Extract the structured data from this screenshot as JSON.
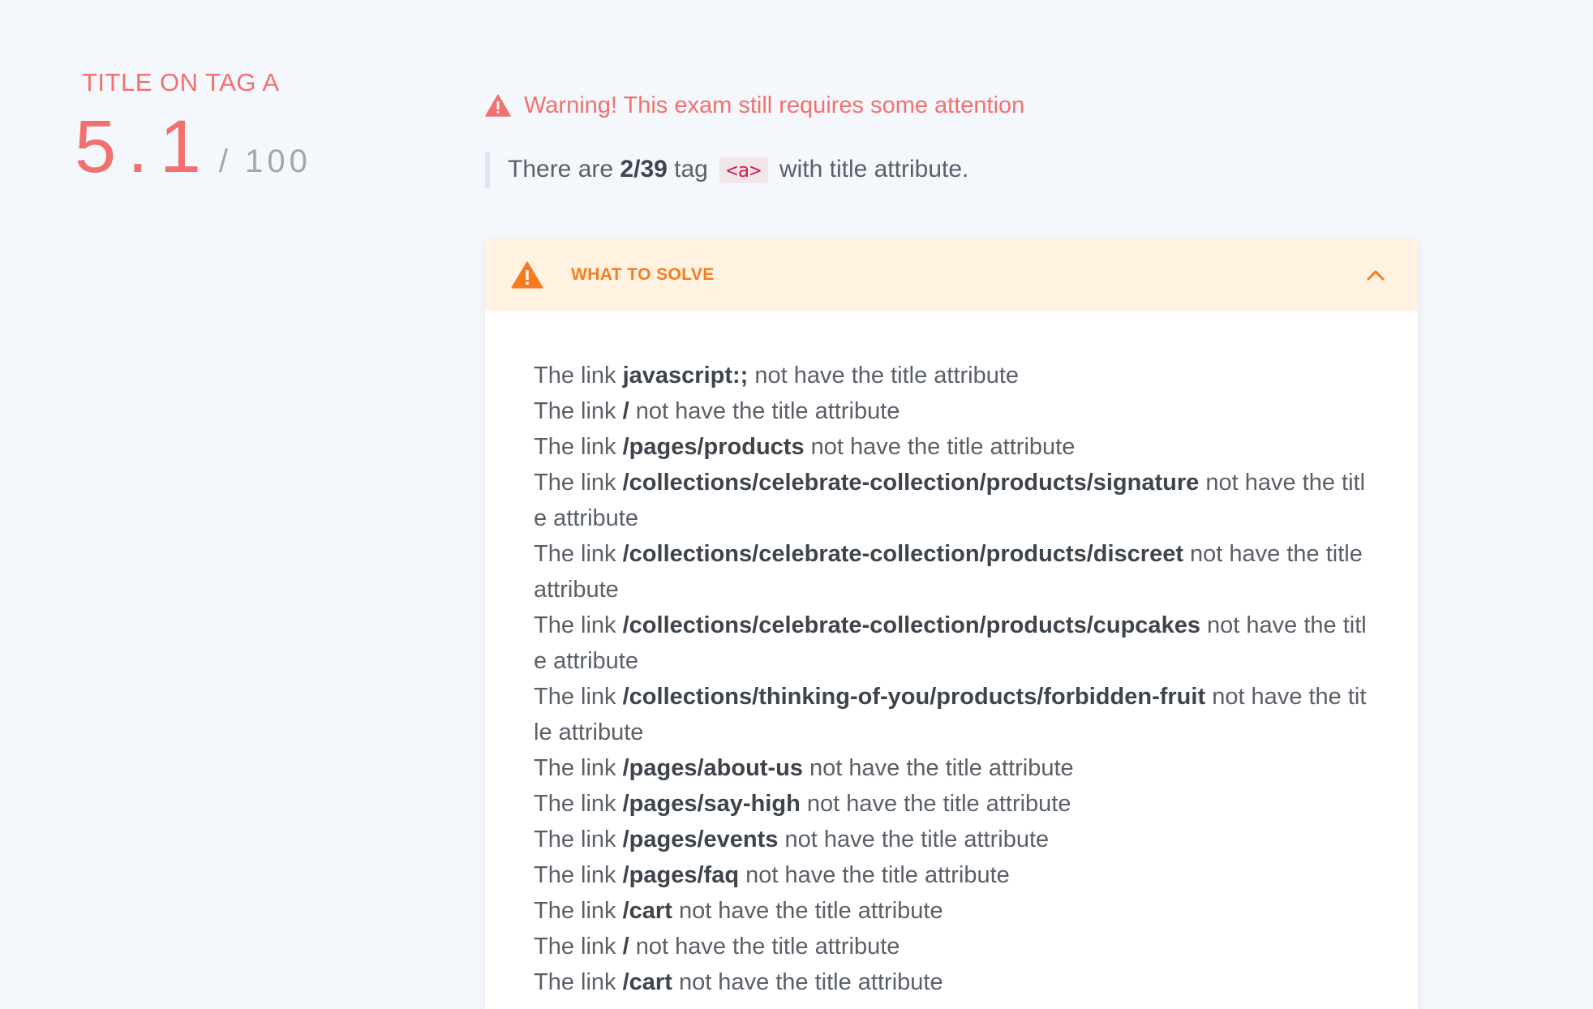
{
  "score": {
    "title": "TITLE ON TAG A",
    "value": "5.1",
    "max": "/ 100"
  },
  "warning": {
    "icon": "warning-triangle-icon",
    "text": "Warning! This exam still requires some attention",
    "color": "#f2716f"
  },
  "summary": {
    "prefix": "There are",
    "count": "2/39",
    "middle": "tag",
    "tag": "<a>",
    "suffix": "with title attribute."
  },
  "solve_panel": {
    "icon": "warning-triangle-icon",
    "label": "WHAT TO SOLVE",
    "toggle_icon": "chevron-up-icon",
    "accent_color": "#f57c1f",
    "header_bg": "#fff2e0",
    "items": [
      {
        "prefix": "The link",
        "link": "javascript:;",
        "suffix": "not have the title attribute"
      },
      {
        "prefix": "The link",
        "link": "/",
        "suffix": "not have the title attribute"
      },
      {
        "prefix": "The link",
        "link": "/pages/products",
        "suffix": "not have the title attribute"
      },
      {
        "prefix": "The link",
        "link": "/collections/celebrate-collection/products/signature",
        "suffix": "not have the title attribute"
      },
      {
        "prefix": "The link",
        "link": "/collections/celebrate-collection/products/discreet",
        "suffix": "not have the title attribute"
      },
      {
        "prefix": "The link",
        "link": "/collections/celebrate-collection/products/cupcakes",
        "suffix": "not have the title attribute"
      },
      {
        "prefix": "The link",
        "link": "/collections/thinking-of-you/products/forbidden-fruit",
        "suffix": "not have the title attribute"
      },
      {
        "prefix": "The link",
        "link": "/pages/about-us",
        "suffix": "not have the title attribute"
      },
      {
        "prefix": "The link",
        "link": "/pages/say-high",
        "suffix": "not have the title attribute"
      },
      {
        "prefix": "The link",
        "link": "/pages/events",
        "suffix": "not have the title attribute"
      },
      {
        "prefix": "The link",
        "link": "/pages/faq",
        "suffix": "not have the title attribute"
      },
      {
        "prefix": "The link",
        "link": "/cart",
        "suffix": "not have the title attribute"
      },
      {
        "prefix": "The link",
        "link": "/",
        "suffix": "not have the title attribute"
      },
      {
        "prefix": "The link",
        "link": "/cart",
        "suffix": "not have the title attribute"
      }
    ]
  }
}
